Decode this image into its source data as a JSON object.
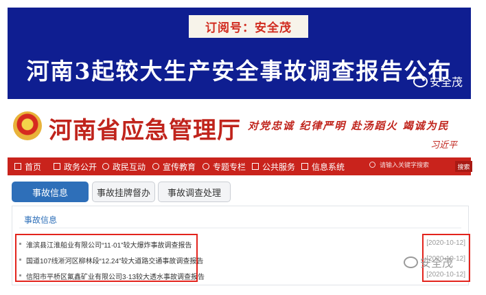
{
  "banner": {
    "subscribe": "订阅号：安全茂",
    "title": "河南3起较大生产安全事故调查报告公布",
    "watermark": "安全茂"
  },
  "header": {
    "site_name": "河南省应急管理厅",
    "motto": "对党忠诚 纪律严明 赴汤蹈火 竭诚为民",
    "signature": "习近平"
  },
  "nav": {
    "items": [
      {
        "label": "首页",
        "icon": "home-icon"
      },
      {
        "label": "政务公开",
        "icon": "doc-icon"
      },
      {
        "label": "政民互动",
        "icon": "chat-icon"
      },
      {
        "label": "宣传教育",
        "icon": "star-icon"
      },
      {
        "label": "专题专栏",
        "icon": "heart-icon"
      },
      {
        "label": "公共服务",
        "icon": "building-icon"
      },
      {
        "label": "信息系统",
        "icon": "grid-icon"
      }
    ],
    "search_placeholder": "请输入关键字搜索",
    "search_button": "搜索"
  },
  "tabs": [
    {
      "label": "事故信息",
      "active": true
    },
    {
      "label": "事故挂牌督办",
      "active": false
    },
    {
      "label": "事故调查处理",
      "active": false
    }
  ],
  "panel": {
    "title": "事故信息",
    "rows": [
      {
        "title": "淮滨县江淮船业有限公司“11·01”较大爆炸事故调查报告",
        "date": "[2020-10-12]"
      },
      {
        "title": "国道107线淅河区柳林段“12.24”较大道路交通事故调查报告",
        "date": "[2020-10-12]"
      },
      {
        "title": "信阳市平桥区氟鑫矿业有限公司3·13较大透水事故调查报告",
        "date": "[2020-10-12]"
      }
    ]
  },
  "watermark": "安全茂",
  "colors": {
    "banner_bg": "#0f1e91",
    "brand_red": "#c9231c",
    "tab_active": "#2e6fb9",
    "highlight": "#e3231c"
  }
}
